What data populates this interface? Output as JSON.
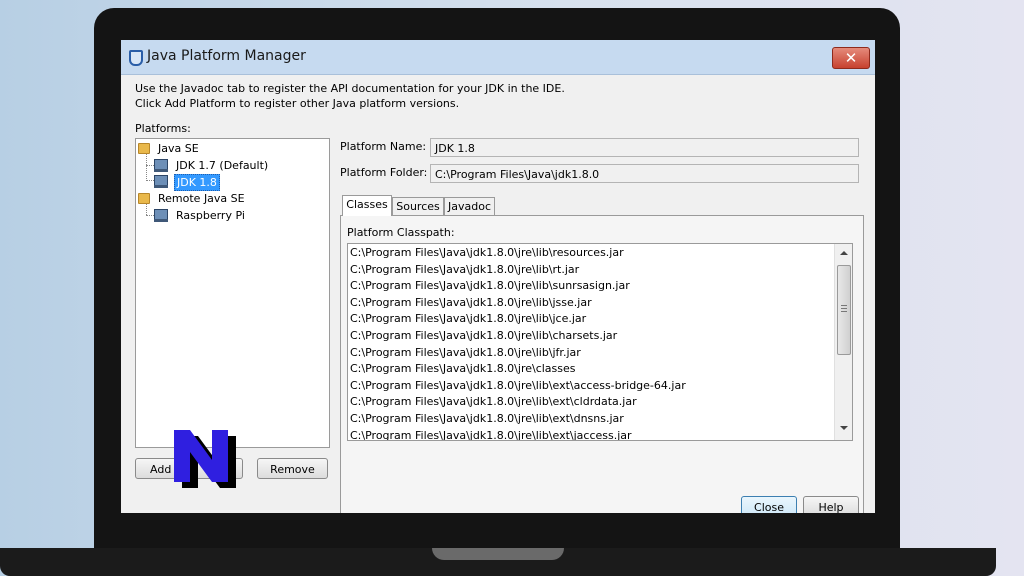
{
  "window": {
    "title": "Java Platform Manager",
    "close_glyph": "✕"
  },
  "description": {
    "line1": "Use the Javadoc tab to register the API documentation for your JDK in the IDE.",
    "line2": "Click Add Platform to register other Java platform versions."
  },
  "platforms": {
    "label": "Platforms:",
    "tree": [
      {
        "label": "Java SE",
        "icon": "folder-icon"
      },
      {
        "label": "JDK 1.7 (Default)",
        "icon": "computer-icon"
      },
      {
        "label": "JDK 1.8",
        "icon": "computer-icon",
        "selected": true
      },
      {
        "label": "Remote Java SE",
        "icon": "folder-icon"
      },
      {
        "label": "Raspberry Pi",
        "icon": "computer-icon"
      }
    ]
  },
  "details": {
    "name_label": "Platform Name:",
    "name_value": "JDK 1.8",
    "folder_label": "Platform Folder:",
    "folder_value": "C:\\Program Files\\Java\\jdk1.8.0"
  },
  "tabs": [
    {
      "label": "Classes",
      "active": true
    },
    {
      "label": "Sources",
      "active": false
    },
    {
      "label": "Javadoc",
      "active": false
    }
  ],
  "classpath": {
    "label": "Platform Classpath:",
    "items": [
      "C:\\Program Files\\Java\\jdk1.8.0\\jre\\lib\\resources.jar",
      "C:\\Program Files\\Java\\jdk1.8.0\\jre\\lib\\rt.jar",
      "C:\\Program Files\\Java\\jdk1.8.0\\jre\\lib\\sunrsasign.jar",
      "C:\\Program Files\\Java\\jdk1.8.0\\jre\\lib\\jsse.jar",
      "C:\\Program Files\\Java\\jdk1.8.0\\jre\\lib\\jce.jar",
      "C:\\Program Files\\Java\\jdk1.8.0\\jre\\lib\\charsets.jar",
      "C:\\Program Files\\Java\\jdk1.8.0\\jre\\lib\\jfr.jar",
      "C:\\Program Files\\Java\\jdk1.8.0\\jre\\classes",
      "C:\\Program Files\\Java\\jdk1.8.0\\jre\\lib\\ext\\access-bridge-64.jar",
      "C:\\Program Files\\Java\\jdk1.8.0\\jre\\lib\\ext\\cldrdata.jar",
      "C:\\Program Files\\Java\\jdk1.8.0\\jre\\lib\\ext\\dnsns.jar",
      "C:\\Program Files\\Java\\jdk1.8.0\\jre\\lib\\ext\\jaccess.jar"
    ]
  },
  "buttons": {
    "add": "Add",
    "remove": "Remove",
    "close": "Close",
    "help": "Help"
  },
  "overlay": {
    "logo_letter": "N",
    "logo_color": "#2f1fe0"
  },
  "colors": {
    "selection": "#3399ff",
    "titlebar": "#c6daf0",
    "close_button": "#c7412e"
  }
}
